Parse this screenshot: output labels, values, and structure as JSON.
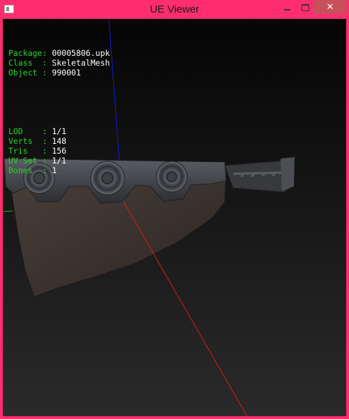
{
  "window": {
    "title": "UE Viewer",
    "close_glyph": "✕"
  },
  "info": {
    "rows1": [
      {
        "label": "Package:",
        "value": "00005806.upk"
      },
      {
        "label": "Class  :",
        "value": "SkeletalMesh"
      },
      {
        "label": "Object :",
        "value": "990001"
      }
    ],
    "rows2": [
      {
        "label": "LOD    :",
        "value": "1/1"
      },
      {
        "label": "Verts  :",
        "value": "148"
      },
      {
        "label": "Tris   :",
        "value": "156"
      },
      {
        "label": "UV Set :",
        "value": "1/1"
      },
      {
        "label": "Bones  :",
        "value": "1"
      }
    ]
  },
  "colors": {
    "label": "#29d429",
    "value": "#ffffff",
    "axis_x": "#e01818",
    "axis_y": "#1a1ad8",
    "axis_z": "#18b818",
    "frame": "#fe2d6f"
  }
}
